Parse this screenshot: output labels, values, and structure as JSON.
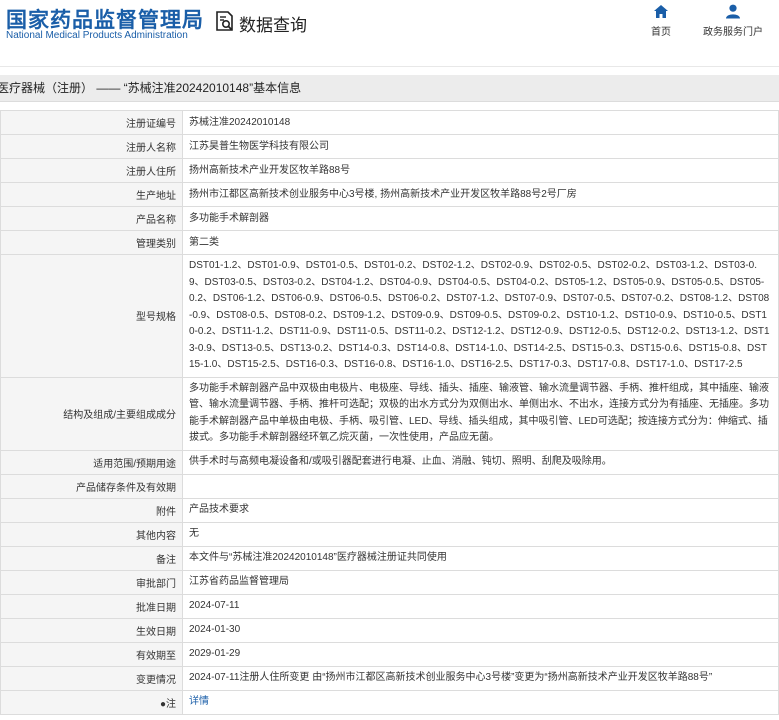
{
  "header": {
    "logo_cn": "国家药品监督管理局",
    "logo_en": "National Medical Products Administration",
    "search_label": "数据查询",
    "nav": [
      {
        "label": "首页",
        "icon": "home-icon"
      },
      {
        "label": "政务服务门户",
        "icon": "user-icon"
      }
    ]
  },
  "breadcrumb": "医疗器械（注册） —— “苏械注准20242010148”基本信息",
  "colors": {
    "brand": "#1a5ea8",
    "label_bg": "#f5f5f5",
    "title_bg": "#ececec"
  },
  "rows": [
    {
      "label": "注册证编号",
      "value": "苏械注准20242010148"
    },
    {
      "label": "注册人名称",
      "value": "江苏昊普生物医学科技有限公司"
    },
    {
      "label": "注册人住所",
      "value": "扬州高新技术产业开发区牧羊路88号"
    },
    {
      "label": "生产地址",
      "value": "扬州市江都区高新技术创业服务中心3号楼, 扬州高新技术产业开发区牧羊路88号2号厂房"
    },
    {
      "label": "产品名称",
      "value": "多功能手术解剖器"
    },
    {
      "label": "管理类别",
      "value": "第二类"
    },
    {
      "label": "型号规格",
      "value": "DST01-1.2、DST01-0.9、DST01-0.5、DST01-0.2、DST02-1.2、DST02-0.9、DST02-0.5、DST02-0.2、DST03-1.2、DST03-0.9、DST03-0.5、DST03-0.2、DST04-1.2、DST04-0.9、DST04-0.5、DST04-0.2、DST05-1.2、DST05-0.9、DST05-0.5、DST05-0.2、DST06-1.2、DST06-0.9、DST06-0.5、DST06-0.2、DST07-1.2、DST07-0.9、DST07-0.5、DST07-0.2、DST08-1.2、DST08-0.9、DST08-0.5、DST08-0.2、DST09-1.2、DST09-0.9、DST09-0.5、DST09-0.2、DST10-1.2、DST10-0.9、DST10-0.5、DST10-0.2、DST11-1.2、DST11-0.9、DST11-0.5、DST11-0.2、DST12-1.2、DST12-0.9、DST12-0.5、DST12-0.2、DST13-1.2、DST13-0.9、DST13-0.5、DST13-0.2、DST14-0.3、DST14-0.8、DST14-1.0、DST14-2.5、DST15-0.3、DST15-0.6、DST15-0.8、DST15-1.0、DST15-2.5、DST16-0.3、DST16-0.8、DST16-1.0、DST16-2.5、DST17-0.3、DST17-0.8、DST17-1.0、DST17-2.5"
    },
    {
      "label": "结构及组成/主要组成成分",
      "value": "多功能手术解剖器产品中双极由电极片、电极座、导线、插头、插座、输液管、输水流量调节器、手柄、推杆组成，其中插座、输液管、输水流量调节器、手柄、推杆可选配；双极的出水方式分为双侧出水、单侧出水、不出水，连接方式分为有插座、无插座。多功能手术解剖器产品中单极由电极、手柄、吸引管、LED、导线、插头组成，其中吸引管、LED可选配；按连接方式分为：伸缩式、插拔式。多功能手术解剖器经环氧乙烷灭菌，一次性使用，产品应无菌。"
    },
    {
      "label": "适用范围/预期用途",
      "value": "供手术时与高频电凝设备和/或吸引器配套进行电凝、止血、消融、钝切、照明、刮爬及吸除用。"
    },
    {
      "label": "产品储存条件及有效期",
      "value": ""
    },
    {
      "label": "附件",
      "value": "产品技术要求"
    },
    {
      "label": "其他内容",
      "value": "无"
    },
    {
      "label": "备注",
      "value": "本文件与“苏械注准20242010148”医疗器械注册证共同使用"
    },
    {
      "label": "审批部门",
      "value": "江苏省药品监督管理局"
    },
    {
      "label": "批准日期",
      "value": "2024-07-11"
    },
    {
      "label": "生效日期",
      "value": "2024-01-30"
    },
    {
      "label": "有效期至",
      "value": "2029-01-29"
    },
    {
      "label": "变更情况",
      "value": "2024-07-11注册人住所变更 由“扬州市江都区高新技术创业服务中心3号楼”变更为“扬州高新技术产业开发区牧羊路88号”"
    },
    {
      "label": "●注",
      "value": "详情"
    }
  ]
}
